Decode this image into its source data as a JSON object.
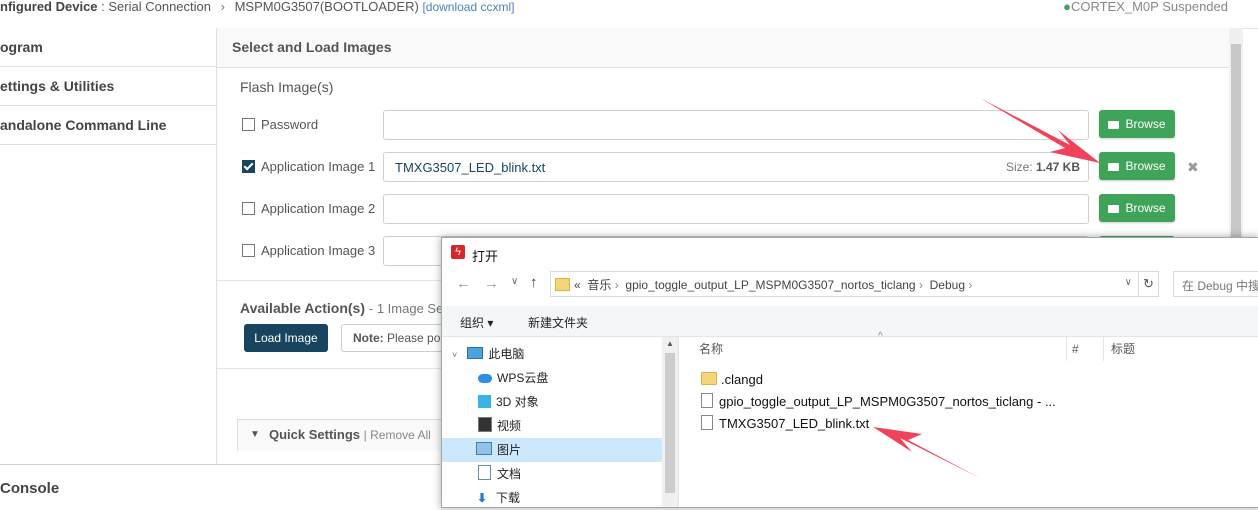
{
  "topbar": {
    "device_label": "nfigured Device",
    "connection": ": Serial Connection",
    "target": "MSPM0G3507(BOOTLOADER)",
    "download_link": "[download ccxml]",
    "status_text": "CORTEX_M0P Suspended"
  },
  "sidebar": {
    "items": [
      {
        "label": "ogram"
      },
      {
        "label": "ettings & Utilities"
      },
      {
        "label": "andalone Command Line"
      }
    ]
  },
  "main": {
    "section_title": "Select and Load Images",
    "flash_heading": "Flash Image(s)",
    "rows": [
      {
        "label": "Password",
        "checked": false,
        "value": "",
        "size_label": "",
        "size_value": "",
        "browse": "Browse"
      },
      {
        "label": "Application Image 1",
        "checked": true,
        "value": "TMXG3507_LED_blink.txt",
        "size_label": "Size:",
        "size_value": "1.47 KB",
        "browse": "Browse"
      },
      {
        "label": "Application Image 2",
        "checked": false,
        "value": "",
        "size_label": "",
        "size_value": "",
        "browse": "Browse"
      },
      {
        "label": "Application Image 3",
        "checked": false,
        "value": "",
        "size_label": "",
        "size_value": "",
        "browse": ""
      }
    ],
    "remove_icon": "✖",
    "actions_heading": "Available Action(s)",
    "actions_sub": "- 1 Image Sele",
    "load_button": "Load Image",
    "note_label": "Note:",
    "note_text": "Please po",
    "quick_settings": "Quick Settings",
    "remove_all": "| Remove All"
  },
  "console": {
    "label": "Console"
  },
  "dialog": {
    "title": "打开",
    "path_prefix": "«",
    "path": [
      "音乐",
      "gpio_toggle_output_LP_MSPM0G3507_nortos_ticlang",
      "Debug"
    ],
    "search_placeholder": "在 Debug 中搜",
    "toolbar": {
      "organize": "组织 ▾",
      "new_folder": "新建文件夹"
    },
    "tree": [
      {
        "label": "此电脑",
        "icon": "computer-icon"
      },
      {
        "label": "WPS云盘",
        "icon": "cloud-icon"
      },
      {
        "label": "3D 对象",
        "icon": "cube-icon"
      },
      {
        "label": "视频",
        "icon": "video-icon"
      },
      {
        "label": "图片",
        "icon": "picture-icon"
      },
      {
        "label": "文档",
        "icon": "document-icon"
      },
      {
        "label": "下载",
        "icon": "download-icon"
      }
    ],
    "columns": {
      "name": "名称",
      "number": "#",
      "title": "标题"
    },
    "files": [
      {
        "name": ".clangd",
        "type": "folder"
      },
      {
        "name": "gpio_toggle_output_LP_MSPM0G3507_nortos_ticlang - ...",
        "type": "file"
      },
      {
        "name": "TMXG3507_LED_blink.txt",
        "type": "file"
      }
    ]
  },
  "colors": {
    "accent_green": "#3fa35a",
    "dark_teal": "#19445f",
    "arrow_red": "#f0425a"
  }
}
